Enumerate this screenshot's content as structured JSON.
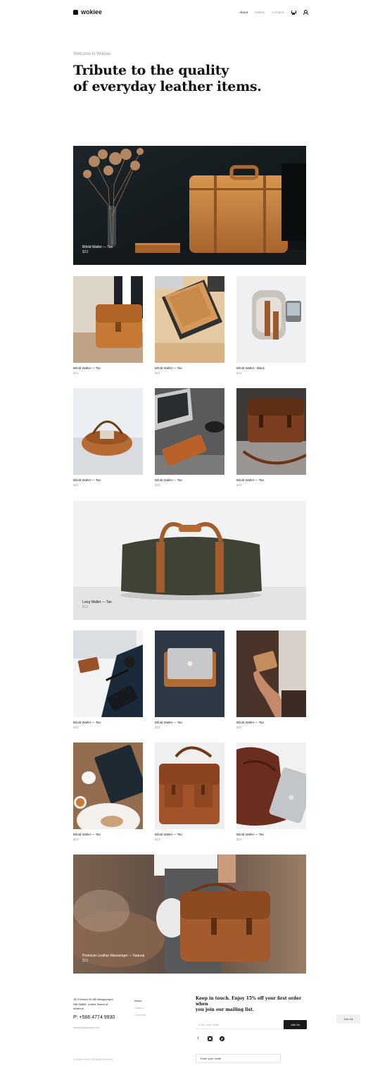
{
  "header": {
    "brand": "wokiee",
    "nav": [
      {
        "label": "About",
        "active": true
      },
      {
        "label": "Gallery",
        "active": false
      },
      {
        "label": "Contacts",
        "active": false
      }
    ],
    "icons": [
      "cart-icon",
      "user-icon"
    ]
  },
  "hero": {
    "kicker": "Welcome to Wokiee",
    "title_line1": "Tribute to the quality",
    "title_line2": "of everyday leather items."
  },
  "features": [
    {
      "name": "Bifold Wallet — Tan",
      "price": "$23"
    },
    {
      "name": "Long Wallet — Tan",
      "price": "$12"
    },
    {
      "name": "Premium Leather Messenger — Natural",
      "price": "$23"
    }
  ],
  "products": [
    {
      "name": "Bifold Wallet — Tan",
      "price": "$23"
    },
    {
      "name": "Bifold Wallet — Tan",
      "price": "$23"
    },
    {
      "name": "Bifold Wallet - Black",
      "price": "$23"
    },
    {
      "name": "Bifold Wallet — Tan",
      "price": "$23"
    },
    {
      "name": "Bifold Wallet — Tan",
      "price": "$23"
    },
    {
      "name": "Bifold Wallet — Tan",
      "price": "$23"
    },
    {
      "name": "Bifold Wallet — Tan",
      "price": "$23"
    },
    {
      "name": "Bifold Wallet — Tan",
      "price": "$23"
    },
    {
      "name": "Bifold Wallet — Tan",
      "price": "$23"
    },
    {
      "name": "Bifold Wallet — Tan",
      "price": "$23"
    },
    {
      "name": "Bifold Wallet — Tan",
      "price": "$23"
    },
    {
      "name": "Bifold Wallet — Tan",
      "price": "$23"
    }
  ],
  "footer": {
    "address_line1": "7th Fremont St NE Albuquerque,",
    "address_line2": "NM 98866, United States of",
    "address_line3": "America",
    "phone": "P: +566 4774 9930",
    "email": "info@mydomain.com",
    "nav": [
      "About",
      "Gallery",
      "Contacts"
    ],
    "newsletter_line1": "Keep in touch. Enjoy 15% off your first order when",
    "newsletter_line2": "you join our mailing list.",
    "email_placeholder": "Enter your email",
    "join_label": "Join Us",
    "social_icons": [
      "facebook-icon",
      "instagram-icon",
      "pinterest-icon"
    ],
    "copyright": "© Wokiee 2019. All Rights Reserved."
  },
  "floating": {
    "join_label": "Join Us",
    "email_placeholder": "Enter your email"
  }
}
